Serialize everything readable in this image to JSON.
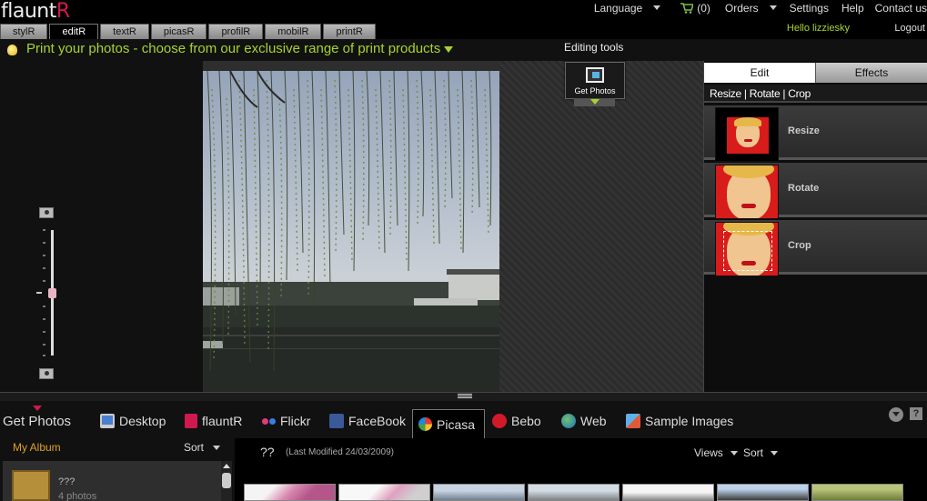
{
  "header": {
    "logo_main": "flaunt",
    "logo_accent": "R",
    "nav": {
      "language": "Language",
      "cart_count": "(0)",
      "orders": "Orders",
      "settings": "Settings",
      "help": "Help",
      "contact": "Contact us"
    },
    "greeting": "Hello lizziesky",
    "logout": "Logout"
  },
  "tabs": [
    {
      "label": "stylR",
      "active": false
    },
    {
      "label": "editR",
      "active": true
    },
    {
      "label": "textR",
      "active": false
    },
    {
      "label": "picasR",
      "active": false
    },
    {
      "label": "profilR",
      "active": false
    },
    {
      "label": "mobilR",
      "active": false
    },
    {
      "label": "printR",
      "active": false
    }
  ],
  "promo": {
    "text": "Print your photos - choose from our exclusive range of print products"
  },
  "editor": {
    "editing_tools_label": "Editing tools",
    "get_photos_button": "Get Photos"
  },
  "right_panel": {
    "tabs": [
      {
        "label": "Edit",
        "active": true
      },
      {
        "label": "Effects",
        "active": false
      }
    ],
    "subheader": "Resize | Rotate | Crop",
    "tools": [
      {
        "label": "Resize"
      },
      {
        "label": "Rotate"
      },
      {
        "label": "Crop"
      }
    ]
  },
  "get_photos": {
    "title": "Get Photos",
    "sources": [
      {
        "label": "Desktop",
        "icon": "monitor-icon",
        "active": false
      },
      {
        "label": "flauntR",
        "icon": "flauntr-icon",
        "active": false
      },
      {
        "label": "Flickr",
        "icon": "flickr-icon",
        "active": false
      },
      {
        "label": "FaceBook",
        "icon": "facebook-icon",
        "active": false
      },
      {
        "label": "Picasa",
        "icon": "picasa-icon",
        "active": true
      },
      {
        "label": "Bebo",
        "icon": "bebo-icon",
        "active": false
      },
      {
        "label": "Web",
        "icon": "globe-icon",
        "active": false
      },
      {
        "label": "Sample Images",
        "icon": "sample-images-icon",
        "active": false
      }
    ],
    "help": "?"
  },
  "album": {
    "my_album": "My Album",
    "sort": "Sort",
    "items": [
      {
        "name": "???",
        "count": "4 photos"
      }
    ]
  },
  "photos": {
    "album_title": "??",
    "last_modified": "(Last Modified 24/03/2009)",
    "views": "Views",
    "sort": "Sort"
  },
  "colors": {
    "accent_green": "#a7d32f",
    "brand_red": "#d0194f",
    "album_orange": "#e0a125"
  }
}
